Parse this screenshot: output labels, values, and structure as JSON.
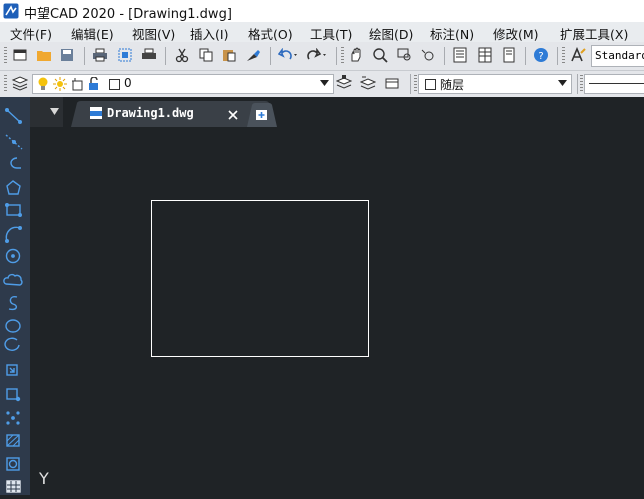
{
  "window": {
    "title": "中望CAD 2020 - [Drawing1.dwg]"
  },
  "menu": [
    "文件(F)",
    "编辑(E)",
    "视图(V)",
    "插入(I)",
    "格式(O)",
    "工具(T)",
    "绘图(D)",
    "标注(N)",
    "修改(M)",
    "扩展工具(X)"
  ],
  "toolbar": {
    "text_style": "Standard"
  },
  "layer": {
    "current": "0",
    "color_value": "随层"
  },
  "tabs": [
    {
      "label": "Drawing1.dwg"
    }
  ],
  "canvas": {
    "ucs_label": "Y"
  },
  "icons": {
    "draw_tools": [
      "line-icon",
      "construction-line-icon",
      "polyline-icon",
      "polygon-icon",
      "rectangle-icon",
      "arc-icon",
      "circle-icon",
      "revision-cloud-icon",
      "spline-icon",
      "ellipse-icon",
      "ellipse-arc-icon",
      "insert-block-icon",
      "make-block-icon",
      "point-icon",
      "hatch-icon",
      "region-icon",
      "table-icon"
    ]
  },
  "colors": {
    "accent": "#2e7bd6",
    "canvas": "#1f2326",
    "toolbar": "#e4e6ea",
    "left_panel": "#2e3a4b"
  }
}
